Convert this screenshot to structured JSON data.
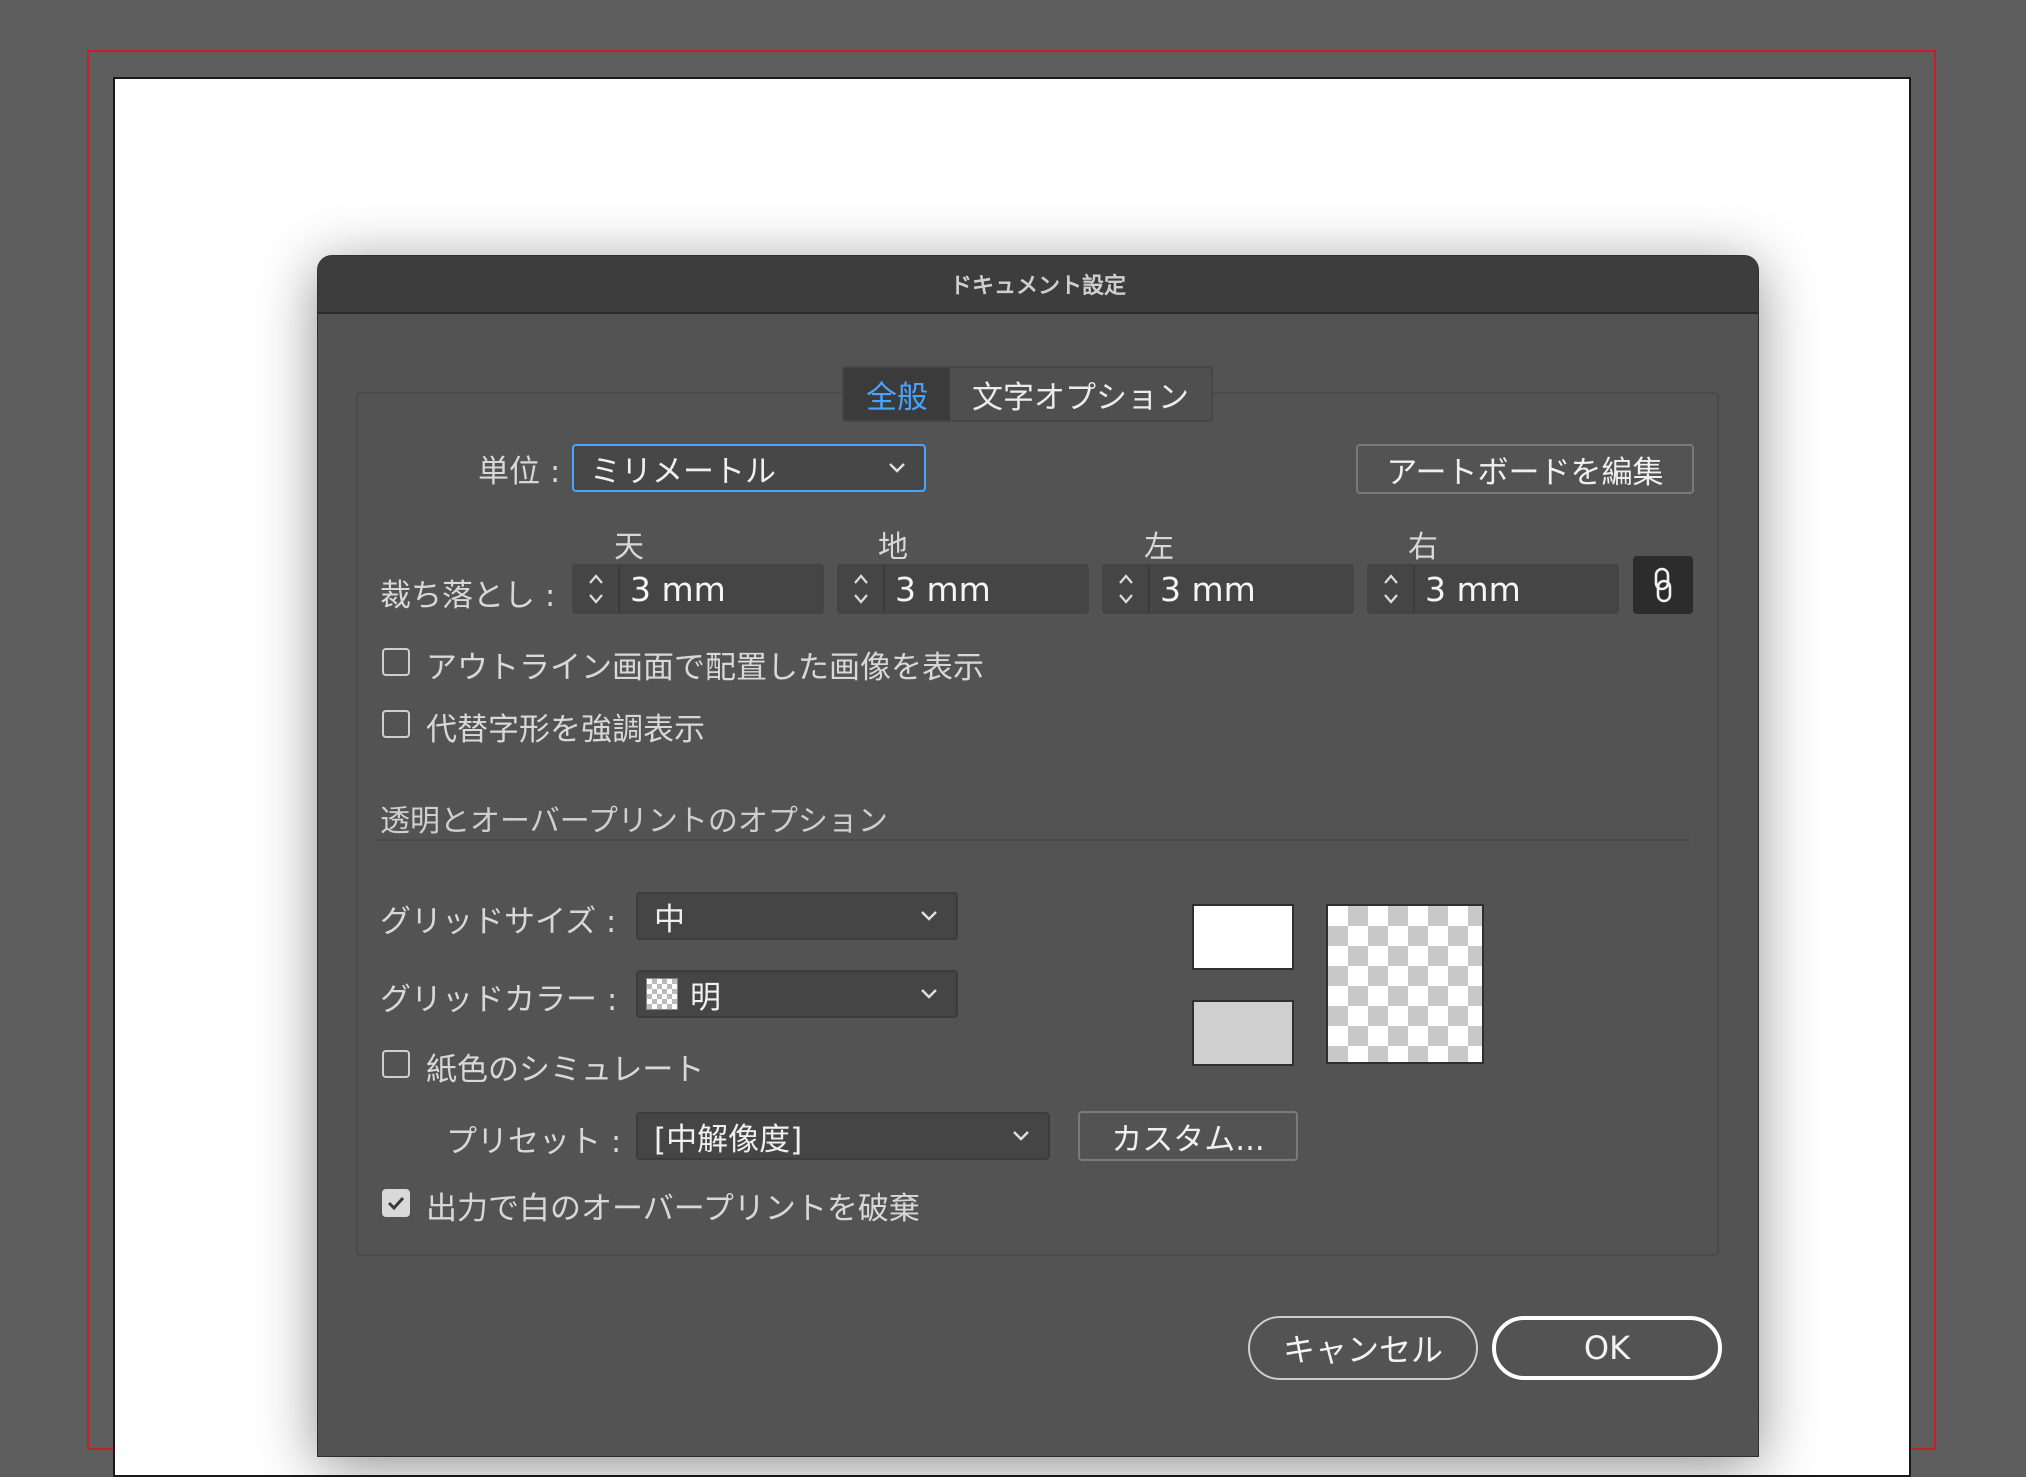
{
  "dialog": {
    "title": "ドキュメント設定"
  },
  "tabs": [
    {
      "label": "全般",
      "active": true
    },
    {
      "label": "文字オプション",
      "active": false
    }
  ],
  "units": {
    "label": "単位 :",
    "value": "ミリメートル"
  },
  "edit_artboard_label": "アートボードを編集",
  "bleed": {
    "label": "裁ち落とし :",
    "fields": [
      {
        "header": "天",
        "value": "3 mm"
      },
      {
        "header": "地",
        "value": "3 mm"
      },
      {
        "header": "左",
        "value": "3 mm"
      },
      {
        "header": "右",
        "value": "3 mm"
      }
    ]
  },
  "checkboxes": {
    "show_images_outline": {
      "label": "アウトライン画面で配置した画像を表示",
      "checked": false
    },
    "highlight_alt_glyphs": {
      "label": "代替字形を強調表示",
      "checked": false
    },
    "simulate_paper": {
      "label": "紙色のシミュレート",
      "checked": false
    },
    "discard_white_overprint": {
      "label": "出力で白のオーバープリントを破棄",
      "checked": true
    }
  },
  "transparency": {
    "section_title": "透明とオーバープリントのオプション",
    "grid_size": {
      "label": "グリッドサイズ :",
      "value": "中"
    },
    "grid_color": {
      "label": "グリッドカラー :",
      "value": "明"
    },
    "preset": {
      "label": "プリセット :",
      "value": "[中解像度]"
    },
    "custom_label": "カスタム..."
  },
  "buttons": {
    "cancel": "キャンセル",
    "ok": "OK"
  },
  "colors": {
    "accent": "#4aa3ff",
    "bleed_guide": "#c8202a",
    "dialog_bg": "#535353",
    "swatch_gray": "#cfcfcf"
  }
}
